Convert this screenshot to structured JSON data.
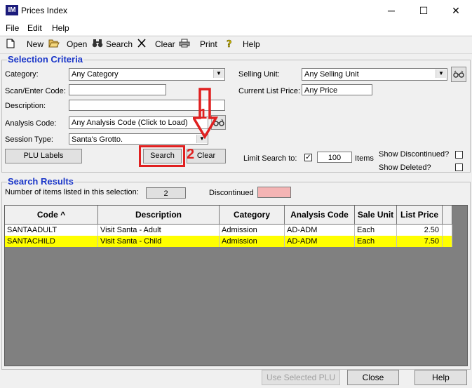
{
  "window": {
    "app_icon_text": "IM",
    "title": "Prices Index",
    "minimize": "─",
    "maximize": "☐",
    "close": "✕"
  },
  "menu": {
    "file": "File",
    "edit": "Edit",
    "help": "Help"
  },
  "toolbar": {
    "new_label": "New",
    "open_label": "Open",
    "search_label": "Search",
    "clear_label": "Clear",
    "print_label": "Print",
    "help_label": "Help"
  },
  "selection": {
    "title": "Selection Criteria",
    "category_label": "Category:",
    "category_value": "Any Category",
    "scan_label": "Scan/Enter Code:",
    "scan_value": "",
    "description_label": "Description:",
    "description_value": "",
    "analysis_label": "Analysis Code:",
    "analysis_value": "Any Analysis Code (Click to Load)",
    "session_label": "Session Type:",
    "session_value": "Santa's Grotto.",
    "selling_unit_label": "Selling Unit:",
    "selling_unit_value": "Any Selling Unit",
    "list_price_label": "Current List Price:",
    "list_price_value": "Any Price",
    "plu_labels_button": "PLU Labels",
    "search_button": "Search",
    "clear_button": "Clear",
    "limit_label": "Limit Search to:",
    "limit_checked": "✓",
    "limit_value": "100",
    "items_label": "Items",
    "show_discontinued_label": "Show Discontinued?",
    "show_deleted_label": "Show Deleted?"
  },
  "results": {
    "title": "Search Results",
    "count_label": "Number of items listed in this selection:",
    "count_value": "2",
    "discontinued_label": "Discontinued",
    "discontinued_color": "#f4b4b4",
    "columns": [
      "Code ^",
      "Description",
      "Category",
      "Analysis Code",
      "Sale Unit",
      "List Price"
    ],
    "rows": [
      {
        "code": "SANTAADULT",
        "description": "Visit Santa - Adult",
        "category": "Admission",
        "analysis": "AD-ADM",
        "unit": "Each",
        "price": "2.50"
      },
      {
        "code": "SANTACHILD",
        "description": "Visit Santa - Child",
        "category": "Admission",
        "analysis": "AD-ADM",
        "unit": "Each",
        "price": "7.50"
      }
    ],
    "selected_row_color": "#ffff00"
  },
  "footer": {
    "use_selected_plu": "Use Selected PLU",
    "close": "Close",
    "help": "Help"
  },
  "annotations": {
    "step1": "1",
    "step2": "2",
    "color": "#e02020"
  }
}
